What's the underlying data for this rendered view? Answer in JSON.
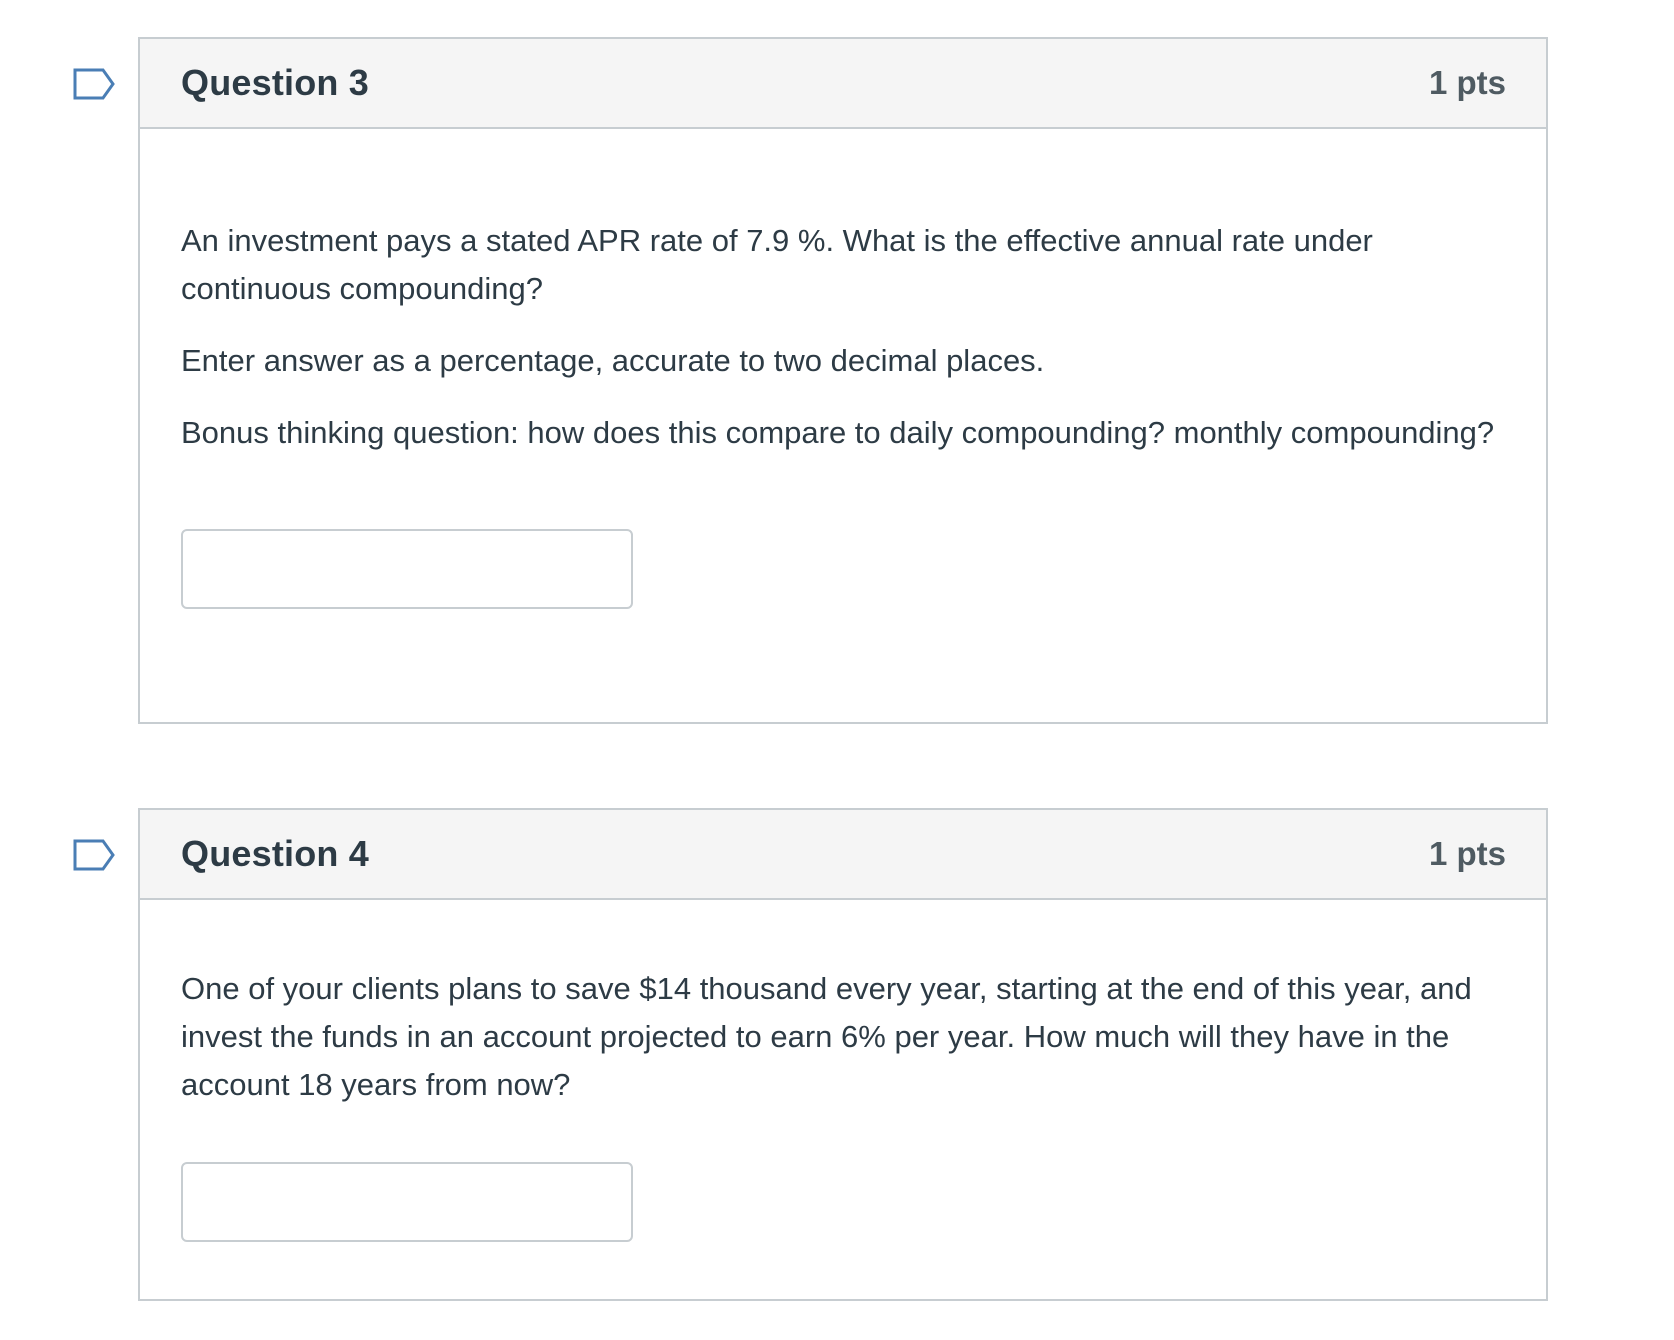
{
  "colors": {
    "border": "#c7cdd1",
    "header_bg": "#f5f5f5",
    "text": "#2d3b45",
    "flag_icon": "#4a7eb5"
  },
  "questions": [
    {
      "title": "Question 3",
      "points": "1 pts",
      "flag_icon": "flag-outline-icon",
      "paragraphs": [
        "An investment pays a stated APR rate of 7.9 %. What is the effective annual rate under continuous compounding?",
        "Enter answer as a percentage, accurate to two decimal places.",
        "Bonus thinking question: how does this compare to daily compounding? monthly compounding?"
      ],
      "answer": {
        "value": "",
        "placeholder": ""
      }
    },
    {
      "title": "Question 4",
      "points": "1 pts",
      "flag_icon": "flag-outline-icon",
      "paragraphs": [
        "One of your clients plans to save $14 thousand every year, starting at the end of this year, and invest the funds in an account projected to earn 6% per year. How much will they have in the account 18 years from now?"
      ],
      "answer": {
        "value": "",
        "placeholder": ""
      }
    }
  ]
}
